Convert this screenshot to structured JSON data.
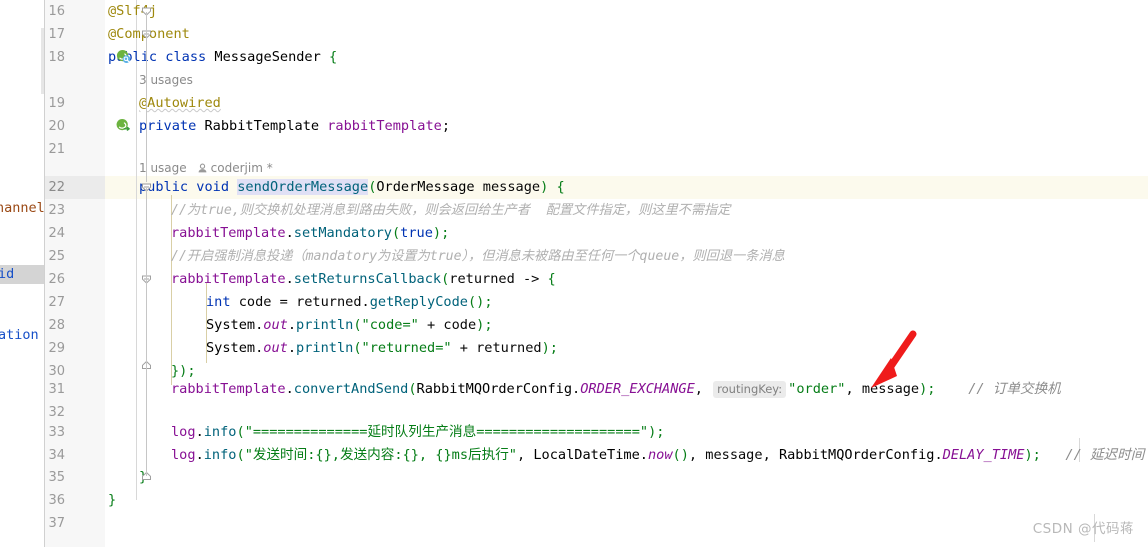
{
  "app": {
    "name": "IntelliJ IDEA Java Editor",
    "file_language": "Java"
  },
  "left_panel_fragments": [
    {
      "text": "hannel):v",
      "color": "#9b4a16",
      "selected": false
    },
    {
      "text": "id",
      "color": "#1750c8",
      "selected": true
    },
    {
      "text": "ation",
      "color": "#1750c8",
      "selected": false
    }
  ],
  "gutter": {
    "line_numbers": [
      "16",
      "17",
      "18",
      "19",
      "20",
      "21",
      "22",
      "23",
      "24",
      "25",
      "26",
      "27",
      "28",
      "29",
      "30",
      "31",
      "32",
      "33",
      "34",
      "35",
      "36",
      "37"
    ],
    "icons": [
      {
        "line": "18",
        "name": "spring-bean-class-icon"
      },
      {
        "line": "20",
        "name": "spring-bean-autowired-icon"
      }
    ],
    "fold_markers": [
      "16",
      "17",
      "22",
      "26",
      "30",
      "35"
    ]
  },
  "inlay_hints": {
    "usages_class": "3 usages",
    "usages_method": "1 usage",
    "author": "coderjim *"
  },
  "code": {
    "line16": {
      "num": "16",
      "annotation": "@Slf4j"
    },
    "line17": {
      "num": "17",
      "annotation": "@Component"
    },
    "line18": {
      "num": "18",
      "kw_public": "public",
      "kw_class": "class",
      "class_name": "MessageSender",
      "brace": "{"
    },
    "line19": {
      "num": "19",
      "annotation": "@Autowired"
    },
    "line20": {
      "num": "20",
      "kw_private": "private",
      "type": "RabbitTemplate",
      "field": "rabbitTemplate",
      "semi": ";"
    },
    "line21": {
      "num": "21",
      "text": ""
    },
    "line22": {
      "num": "22",
      "kw_public": "public",
      "kw_void": "void",
      "method": "sendOrderMessage",
      "paren_open": "(",
      "param_type": "OrderMessage",
      "param_name": "message",
      "paren_close": ")",
      "brace": "{"
    },
    "line23": {
      "num": "23",
      "comment": "//为true,则交换机处理消息到路由失败，则会返回给生产者  配置文件指定，则这里不需指定"
    },
    "line24": {
      "num": "24",
      "receiver": "rabbitTemplate",
      "dot": ".",
      "method": "setMandatory",
      "paren_open": "(",
      "arg": "true",
      "tail": ");"
    },
    "line25": {
      "num": "25",
      "comment": "//开启强制消息投递（mandatory为设置为true），但消息未被路由至任何一个queue，则回退一条消息"
    },
    "line26": {
      "num": "26",
      "receiver": "rabbitTemplate",
      "dot": ".",
      "method": "setReturnsCallback",
      "paren_open": "(",
      "lambda_param": "returned",
      "arrow": " -> ",
      "brace": "{"
    },
    "line27": {
      "num": "27",
      "kw_int": "int",
      "var": "code",
      "eq": " = ",
      "receiver": "returned",
      "dot": ".",
      "method": "getReplyCode",
      "tail": "();"
    },
    "line28": {
      "num": "28",
      "cls": "System",
      "dot1": ".",
      "sfield": "out",
      "dot2": ".",
      "method": "println",
      "paren_open": "(",
      "string": "\"code=\"",
      "plus": " + ",
      "arg": "code",
      "tail": ");"
    },
    "line29": {
      "num": "29",
      "cls": "System",
      "dot1": ".",
      "sfield": "out",
      "dot2": ".",
      "method": "println",
      "paren_open": "(",
      "string": "\"returned=\"",
      "plus": " + ",
      "arg": "returned",
      "tail": ");"
    },
    "line30": {
      "num": "30",
      "text": "});"
    },
    "line31": {
      "num": "31",
      "receiver": "rabbitTemplate",
      "dot": ".",
      "method": "convertAndSend",
      "paren_open": "(",
      "const_class": "RabbitMQOrderConfig",
      "const_dot": ".",
      "const_name": "ORDER_EXCHANGE",
      "comma1": ", ",
      "param_hint": "routingKey:",
      "routing_key": "\"order\"",
      "comma2": ", ",
      "arg_message": "message",
      "tail": ");",
      "trailing_comment": "// 订单交换机"
    },
    "line32": {
      "num": "32",
      "text": ""
    },
    "line33": {
      "num": "33",
      "logger": "log",
      "dot": ".",
      "method": "info",
      "paren_open": "(",
      "string": "\"==============延时队列生产消息====================\"",
      "tail": ");"
    },
    "line34": {
      "num": "34",
      "logger": "log",
      "dot": ".",
      "method": "info",
      "paren_open": "(",
      "string": "\"发送时间:{},发送内容:{}, {}ms后执行\"",
      "comma1": ", ",
      "arg1_cls": "LocalDateTime",
      "arg1_dot": ".",
      "arg1_mth": "now",
      "arg1_tail": "()",
      "comma2": ", ",
      "arg2": "message",
      "comma3": ", ",
      "arg3_cls": "RabbitMQOrderConfig",
      "arg3_dot": ".",
      "arg3_const": "DELAY_TIME",
      "tail": ");",
      "trailing_comment": "// 延迟时间（单"
    },
    "line35": {
      "num": "35",
      "text": "}"
    },
    "line36": {
      "num": "36",
      "text": "}"
    },
    "line37": {
      "num": "37",
      "text": ""
    }
  },
  "annotation": {
    "arrow_color": "#ef1b1b",
    "arrow_target": "message"
  },
  "watermark": {
    "text": "CSDN @代码蒋"
  },
  "colors": {
    "keyword": "#0033b3",
    "annotation": "#9e880d",
    "string": "#067d17",
    "comment": "#8c8c8c",
    "field": "#871094",
    "method": "#00627a",
    "gutter_bg": "#f7f7f7",
    "current_line_bg": "#fcfaed",
    "selection_bg": "#e0e0f5"
  }
}
